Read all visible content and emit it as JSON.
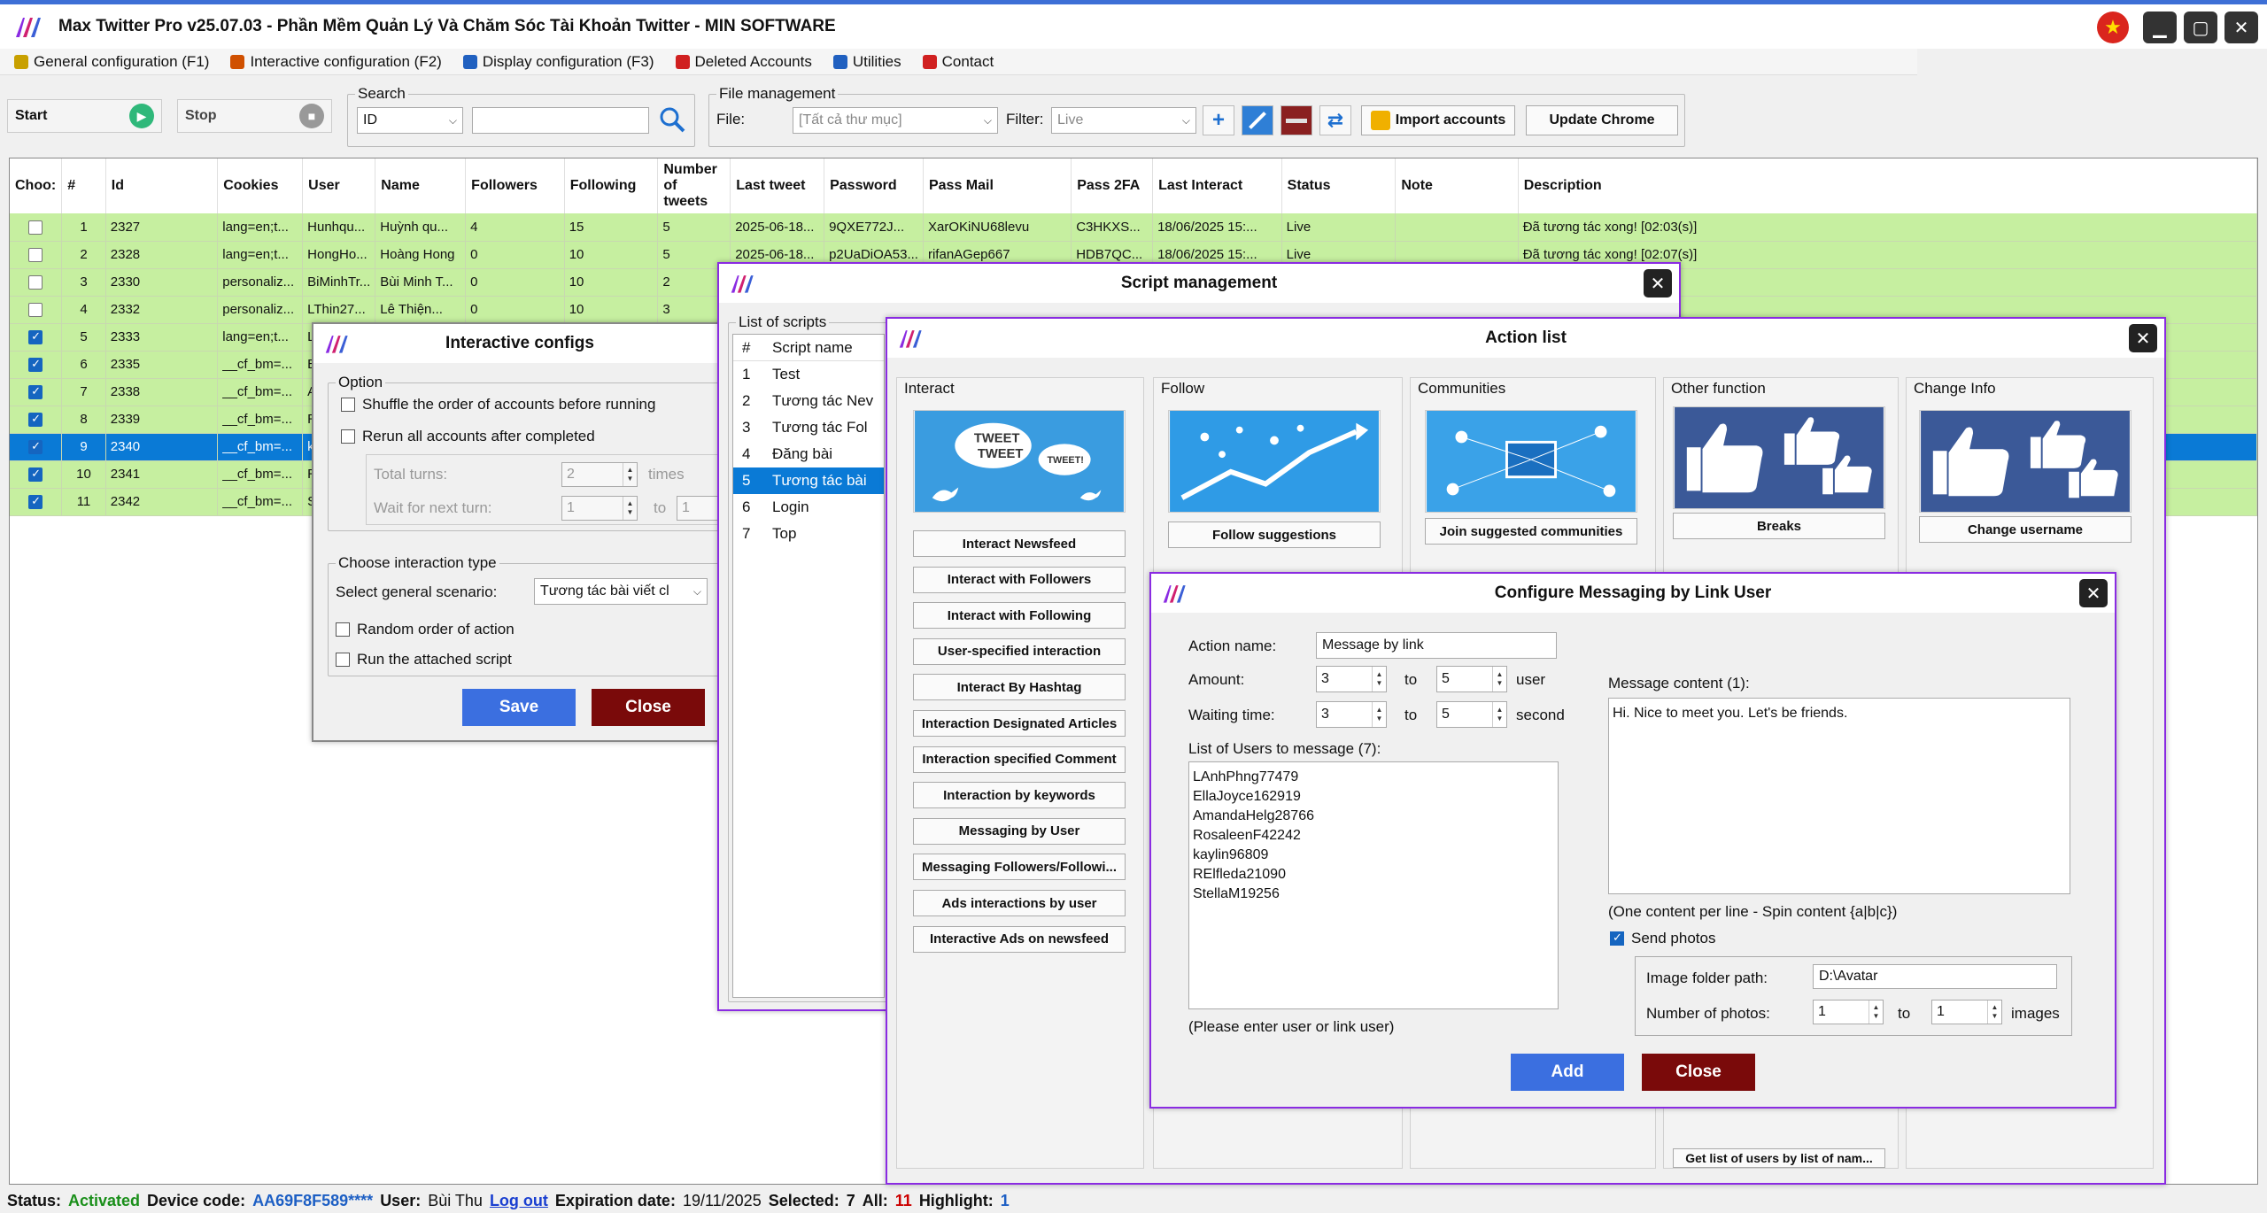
{
  "window": {
    "title": "Max Twitter Pro v25.07.03 - Phần Mềm Quản Lý Và Chăm Sóc Tài Khoản Twitter - MIN SOFTWARE"
  },
  "menu": [
    {
      "label": "General configuration (F1)",
      "icon_color": "#c8a000"
    },
    {
      "label": "Interactive configuration (F2)",
      "icon_color": "#d05000"
    },
    {
      "label": "Display configuration (F3)",
      "icon_color": "#2060c0"
    },
    {
      "label": "Deleted Accounts",
      "icon_color": "#d02020"
    },
    {
      "label": "Utilities",
      "icon_color": "#2060c0"
    },
    {
      "label": "Contact",
      "icon_color": "#d02020"
    }
  ],
  "toolbar": {
    "start_label": "Start",
    "stop_label": "Stop",
    "search_group": "Search",
    "search_field": "ID",
    "search_value": "",
    "file_group": "File management",
    "file_label": "File:",
    "file_value": "[Tất cả thư mục]",
    "filter_label": "Filter:",
    "filter_value": "Live",
    "import_label": "Import accounts",
    "update_label": "Update Chrome"
  },
  "table": {
    "columns": [
      "Choo:",
      "#",
      "Id",
      "Cookies",
      "User",
      "Name",
      "Followers",
      "Following",
      "Number of tweets",
      "Last tweet",
      "Password",
      "Pass Mail",
      "Pass 2FA",
      "Last Interact",
      "Status",
      "Note",
      "Description"
    ],
    "rows": [
      {
        "checked": false,
        "n": "1",
        "id": "2327",
        "cookies": "lang=en;t...",
        "user": "Hunhqu...",
        "name": "Huỳnh qu...",
        "followers": "4",
        "following": "15",
        "tweets": "5",
        "last_tweet": "2025-06-18...",
        "password": "9QXE772J...",
        "pass_mail": "XarOKiNU68levu",
        "pass_2fa": "C3HKXS...",
        "last_interact": "18/06/2025 15:...",
        "status": "Live",
        "note": "",
        "description": "Đã tương tác xong! [02:03(s)]",
        "state": "live"
      },
      {
        "checked": false,
        "n": "2",
        "id": "2328",
        "cookies": "lang=en;t...",
        "user": "HongHo...",
        "name": "Hoàng Hong",
        "followers": "0",
        "following": "10",
        "tweets": "5",
        "last_tweet": "2025-06-18...",
        "password": "p2UaDiOA53...",
        "pass_mail": "rifanAGep667",
        "pass_2fa": "HDB7QC...",
        "last_interact": "18/06/2025 15:...",
        "status": "Live",
        "note": "",
        "description": "Đã tương tác xong! [02:07(s)]",
        "state": "live"
      },
      {
        "checked": false,
        "n": "3",
        "id": "2330",
        "cookies": "personaliz...",
        "user": "BiMinhTr...",
        "name": "Bùi Minh T...",
        "followers": "0",
        "following": "10",
        "tweets": "2",
        "last_tweet": "",
        "password": "",
        "pass_mail": "",
        "pass_2fa": "",
        "last_interact": "",
        "status": "",
        "note": "",
        "description": "",
        "state": "live"
      },
      {
        "checked": false,
        "n": "4",
        "id": "2332",
        "cookies": "personaliz...",
        "user": "LThin27...",
        "name": "Lê Thiện...",
        "followers": "0",
        "following": "10",
        "tweets": "3",
        "last_tweet": "",
        "password": "",
        "pass_mail": "",
        "pass_2fa": "",
        "last_interact": "",
        "status": "",
        "note": "",
        "description": "",
        "state": "live"
      },
      {
        "checked": true,
        "n": "5",
        "id": "2333",
        "cookies": "lang=en;t...",
        "user": "L",
        "name": "",
        "followers": "",
        "following": "",
        "tweets": "",
        "last_tweet": "",
        "password": "",
        "pass_mail": "",
        "pass_2fa": "",
        "last_interact": "",
        "status": "",
        "note": "",
        "description": "",
        "state": "live"
      },
      {
        "checked": true,
        "n": "6",
        "id": "2335",
        "cookies": "__cf_bm=...",
        "user": "E",
        "name": "",
        "followers": "",
        "following": "",
        "tweets": "",
        "last_tweet": "",
        "password": "",
        "pass_mail": "",
        "pass_2fa": "",
        "last_interact": "",
        "status": "",
        "note": "",
        "description": "",
        "state": "live"
      },
      {
        "checked": true,
        "n": "7",
        "id": "2338",
        "cookies": "__cf_bm=...",
        "user": "A",
        "name": "",
        "followers": "",
        "following": "",
        "tweets": "",
        "last_tweet": "",
        "password": "",
        "pass_mail": "",
        "pass_2fa": "",
        "last_interact": "",
        "status": "",
        "note": "",
        "description": "",
        "state": "live"
      },
      {
        "checked": true,
        "n": "8",
        "id": "2339",
        "cookies": "__cf_bm=...",
        "user": "R",
        "name": "",
        "followers": "",
        "following": "",
        "tweets": "",
        "last_tweet": "",
        "password": "",
        "pass_mail": "",
        "pass_2fa": "",
        "last_interact": "",
        "status": "",
        "note": "",
        "description": "",
        "state": "live"
      },
      {
        "checked": true,
        "n": "9",
        "id": "2340",
        "cookies": "__cf_bm=...",
        "user": "k",
        "name": "",
        "followers": "",
        "following": "",
        "tweets": "",
        "last_tweet": "",
        "password": "",
        "pass_mail": "",
        "pass_2fa": "",
        "last_interact": "",
        "status": "",
        "note": "",
        "description": "",
        "state": "sel"
      },
      {
        "checked": true,
        "n": "10",
        "id": "2341",
        "cookies": "__cf_bm=...",
        "user": "R",
        "name": "",
        "followers": "",
        "following": "",
        "tweets": "",
        "last_tweet": "",
        "password": "",
        "pass_mail": "",
        "pass_2fa": "",
        "last_interact": "",
        "status": "",
        "note": "",
        "description": "",
        "state": "live"
      },
      {
        "checked": true,
        "n": "11",
        "id": "2342",
        "cookies": "__cf_bm=...",
        "user": "S",
        "name": "",
        "followers": "",
        "following": "",
        "tweets": "",
        "last_tweet": "",
        "password": "",
        "pass_mail": "",
        "pass_2fa": "",
        "last_interact": "",
        "status": "",
        "note": "",
        "description": "",
        "state": "live"
      }
    ]
  },
  "status_bar": {
    "status_label": "Status:",
    "status_value": "Activated",
    "device_label": "Device code:",
    "device_value": "AA69F8F589****",
    "user_label": "User:",
    "user_value": "Bùi Thu",
    "logout": "Log out",
    "expiration_label": "Expiration date:",
    "expiration_value": "19/11/2025",
    "selected_label": "Selected:",
    "selected_value": "7",
    "all_label": "All:",
    "all_value": "11",
    "highlight_label": "Highlight:",
    "highlight_value": "1"
  },
  "interactive_configs": {
    "title": "Interactive configs",
    "option_group": "Option",
    "shuffle": "Shuffle the order of accounts before running",
    "rerun": "Rerun all accounts after completed",
    "total_turns_label": "Total turns:",
    "total_turns_value": "2",
    "times": "times",
    "wait_label": "Wait for next turn:",
    "wait_value": "1",
    "wait_to": "to",
    "wait_value2": "1",
    "choose_group": "Choose interaction type",
    "scenario_label": "Select general scenario:",
    "scenario_value": "Tương tác bài viết cl",
    "random_order": "Random order of action",
    "run_attached": "Run the attached script",
    "save": "Save",
    "close": "Close"
  },
  "script_management": {
    "title": "Script management",
    "list_group": "List of scripts",
    "col_n": "#",
    "col_name": "Script name",
    "scripts": [
      {
        "n": "1",
        "name": "Test"
      },
      {
        "n": "2",
        "name": "Tương tác Nev"
      },
      {
        "n": "3",
        "name": "Tương tác Fol"
      },
      {
        "n": "4",
        "name": "Đăng bài"
      },
      {
        "n": "5",
        "name": "Tương tác bài"
      },
      {
        "n": "6",
        "name": "Login"
      },
      {
        "n": "7",
        "name": "Top"
      }
    ]
  },
  "action_list": {
    "title": "Action list",
    "interact_head": "Interact",
    "follow_head": "Follow",
    "communities_head": "Communities",
    "other_head": "Other function",
    "change_head": "Change Info",
    "interact_buttons": [
      "Interact Newsfeed",
      "Interact with Followers",
      "Interact with Following",
      "User-specified interaction",
      "Interact By Hashtag",
      "Interaction Designated Articles",
      "Interaction specified Comment",
      "Interaction by keywords",
      "Messaging by User",
      "Messaging Followers/Followi...",
      "Ads interactions by user",
      "Interactive Ads on newsfeed"
    ],
    "follow_suggestions": "Follow suggestions",
    "join_communities": "Join suggested communities",
    "breaks": "Breaks",
    "change_username": "Change username",
    "get_list": "Get list of users by list of nam...",
    "img_tweet_text1": "TWEET",
    "img_tweet_text2": "TWEET",
    "img_tweet_text3": "TWEET!"
  },
  "messaging": {
    "title": "Configure Messaging by Link User",
    "action_name_label": "Action name:",
    "action_name_value": "Message by link",
    "amount_label": "Amount:",
    "amount_from": "3",
    "amount_to_label": "to",
    "amount_to": "5",
    "amount_unit": "user",
    "waiting_label": "Waiting time:",
    "waiting_from": "3",
    "waiting_to_label": "to",
    "waiting_to": "5",
    "waiting_unit": "second",
    "users_label": "List of Users to message (7):",
    "users": [
      "LAnhPhng77479",
      "EllaJoyce162919",
      "AmandaHelg28766",
      "RosaleenF42242",
      "kaylin96809",
      "RElfleda21090",
      "StellaM19256"
    ],
    "users_hint": "(Please enter user or link user)",
    "content_label": "Message content (1):",
    "content_value": "Hi. Nice to meet you. Let's be friends.",
    "content_hint": "(One content per line - Spin content {a|b|c})",
    "send_photos": "Send photos",
    "folder_label": "Image folder path:",
    "folder_value": "D:\\Avatar",
    "photos_label": "Number of photos:",
    "photos_from": "1",
    "photos_to_label": "to",
    "photos_to": "1",
    "photos_unit": "images",
    "add": "Add",
    "close": "Close"
  }
}
